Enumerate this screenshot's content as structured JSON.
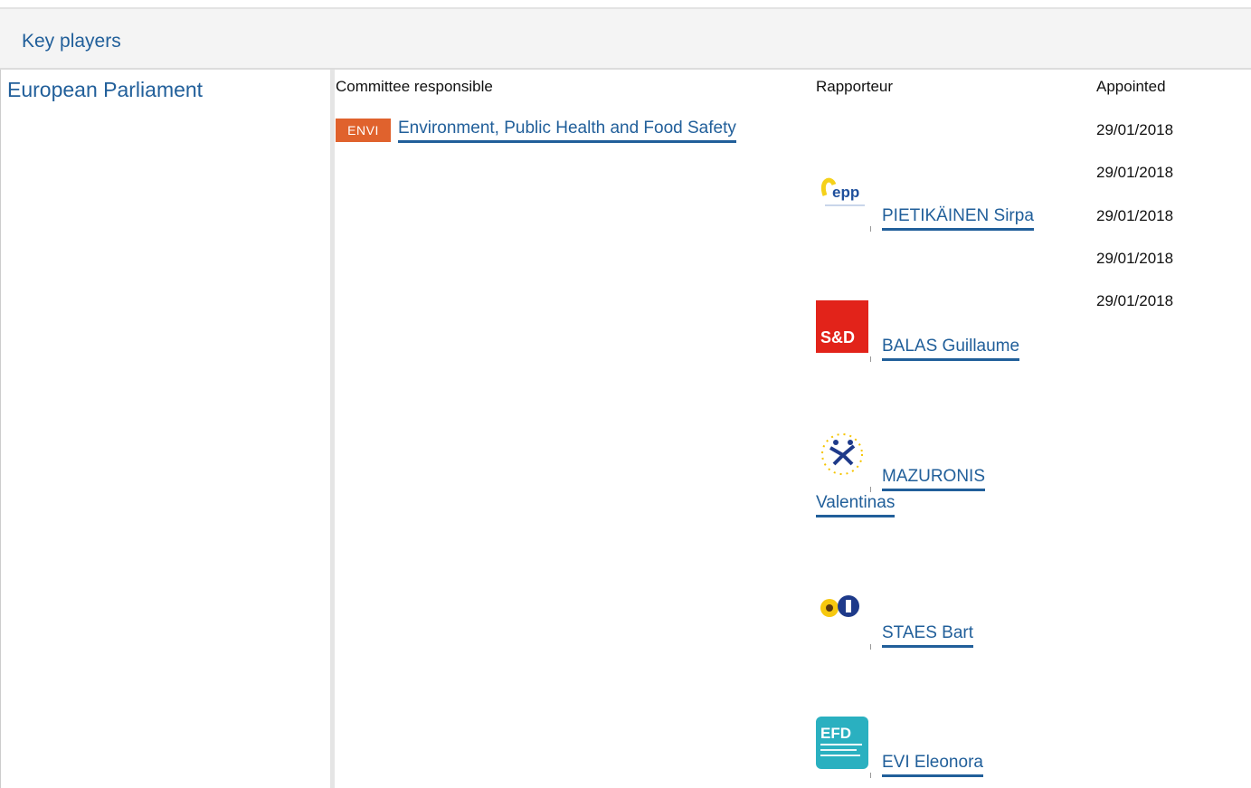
{
  "section": {
    "title": "Key players"
  },
  "institution": {
    "name": "European Parliament"
  },
  "columns": {
    "committee": "Committee responsible",
    "rapporteur": "Rapporteur",
    "appointed": "Appointed"
  },
  "committee": {
    "badge": "ENVI",
    "name": "Environment, Public Health and Food Safety",
    "badge_color": "#e0622d"
  },
  "dates": [
    "29/01/2018",
    "29/01/2018",
    "29/01/2018",
    "29/01/2018",
    "29/01/2018"
  ],
  "rapporteurs": [
    {
      "group_logo": "epp-logo",
      "logo_text": "epp",
      "name": "PIETIKÄINEN Sirpa"
    },
    {
      "group_logo": "sd-logo",
      "logo_text": "S&D",
      "name": "BALAS Guillaume",
      "logo_color": "#e2231a"
    },
    {
      "group_logo": "alde-logo",
      "name_line1": "MAZURONIS",
      "name_line2": "Valentinas"
    },
    {
      "group_logo": "greens-efa-logo",
      "name": "STAES Bart"
    },
    {
      "group_logo": "efdd-logo",
      "logo_text": "EFD",
      "name": "EVI Eleonora",
      "logo_color": "#2ab0c0"
    }
  ],
  "colors": {
    "link": "#215f9a",
    "header_bg": "#f4f4f4"
  }
}
